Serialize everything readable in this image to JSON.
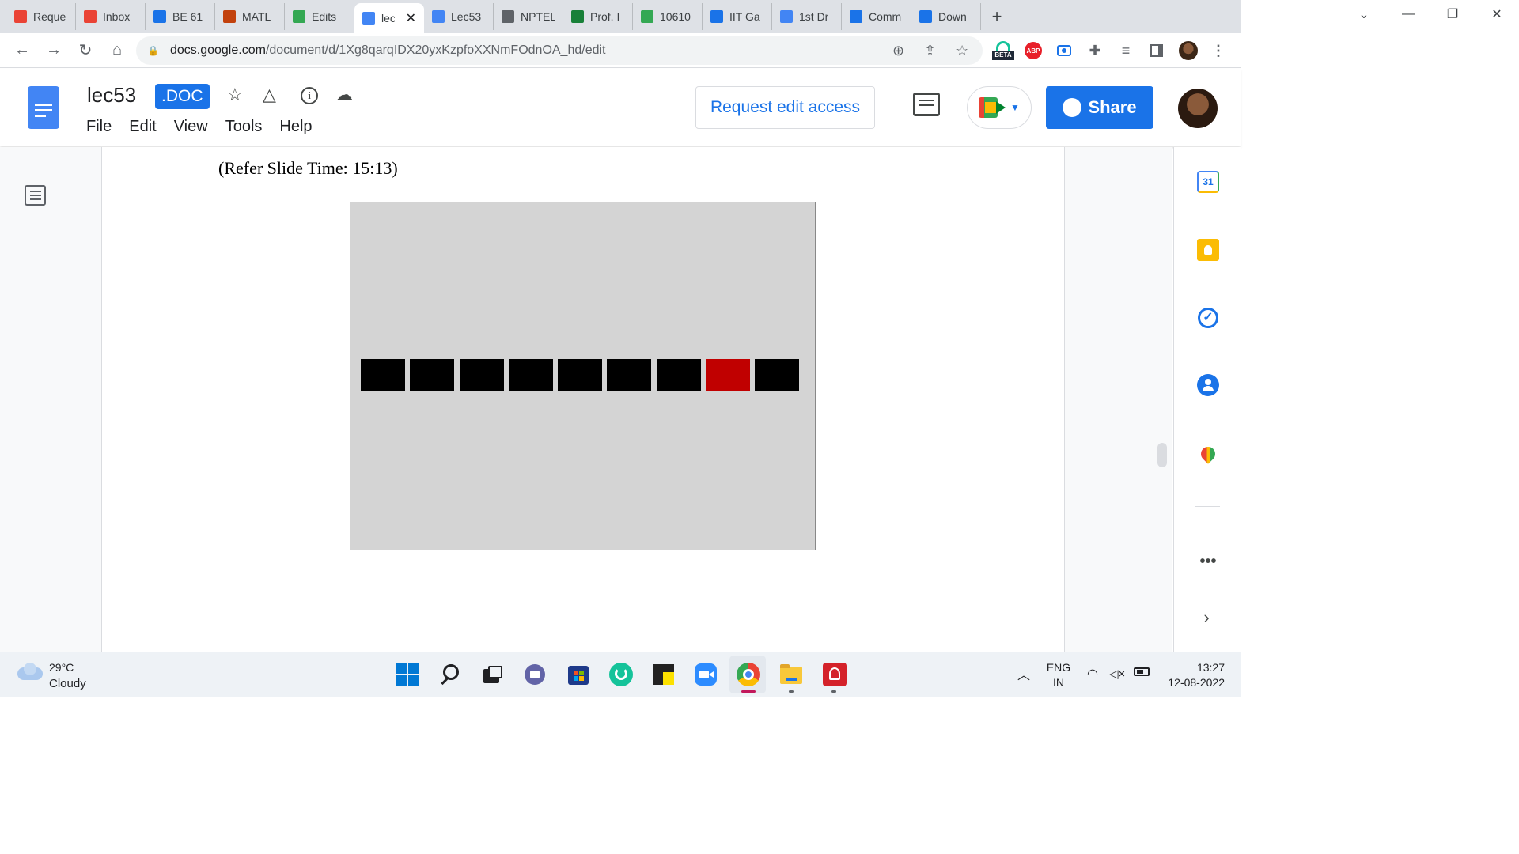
{
  "browser": {
    "tabs": [
      {
        "title": "Reque",
        "icon": "gmail-icon",
        "color": "#ea4335"
      },
      {
        "title": "Inbox",
        "icon": "gmail-icon",
        "color": "#ea4335"
      },
      {
        "title": "BE 61",
        "icon": "classroom-icon",
        "color": "#1a73e8"
      },
      {
        "title": "MATL",
        "icon": "matlab-icon",
        "color": "#c2410c"
      },
      {
        "title": "Edits",
        "icon": "drive-icon",
        "color": "#34a853"
      },
      {
        "title": "lec",
        "icon": "docs-icon",
        "color": "#4285f4",
        "active": true
      },
      {
        "title": "Lec53",
        "icon": "docs-icon",
        "color": "#4285f4"
      },
      {
        "title": "NPTEL",
        "icon": "globe-icon",
        "color": "#5f6368"
      },
      {
        "title": "Prof. I",
        "icon": "sheets-plus-icon",
        "color": "#188038"
      },
      {
        "title": "10610",
        "icon": "drive-icon",
        "color": "#34a853"
      },
      {
        "title": "IIT Ga",
        "icon": "calendar-icon",
        "color": "#1a73e8"
      },
      {
        "title": "1st Dr",
        "icon": "docs-icon",
        "color": "#4285f4"
      },
      {
        "title": "Comm",
        "icon": "jamboard-icon",
        "color": "#1a73e8"
      },
      {
        "title": "Down",
        "icon": "download-icon",
        "color": "#1a73e8"
      }
    ],
    "url_host": "docs.google.com",
    "url_path": "/document/d/1Xg8qarqIDX20yxKzpfoXXNmFOdnOA_hd/edit",
    "beta_label": "BETA",
    "abp_label": "ABP"
  },
  "docs": {
    "title": "lec53",
    "badge": ".DOC",
    "menu": [
      "File",
      "Edit",
      "View",
      "Tools",
      "Help"
    ],
    "request_label": "Request edit access",
    "share_label": "Share"
  },
  "document": {
    "refer_text": "(Refer Slide Time: 15:13)",
    "slide": {
      "square_colors": [
        "#000000",
        "#000000",
        "#000000",
        "#000000",
        "#000000",
        "#000000",
        "#000000",
        "#c00000",
        "#000000"
      ]
    }
  },
  "side_panel": {
    "calendar_label": "31"
  },
  "taskbar": {
    "weather_temp": "29°C",
    "weather_desc": "Cloudy",
    "lang_top": "ENG",
    "lang_bottom": "IN",
    "time": "13:27",
    "date": "12-08-2022"
  }
}
